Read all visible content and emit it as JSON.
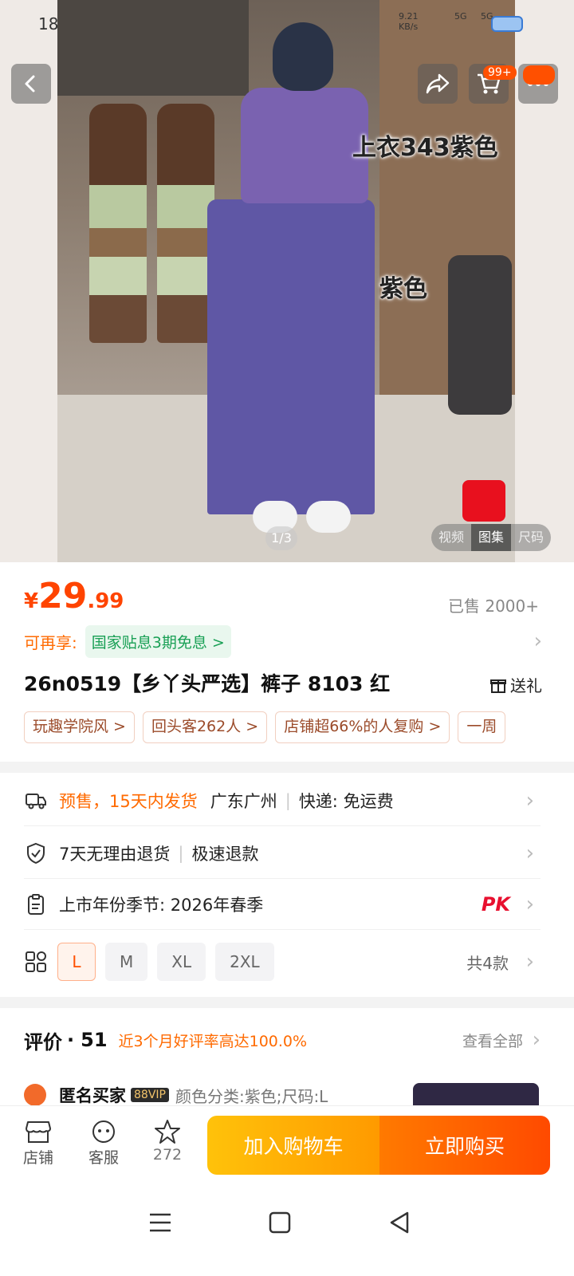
{
  "status_bar": {
    "time": "18",
    "net_speed_value": "9.21",
    "net_speed_unit": "KB/s",
    "sig1": "5G",
    "sig2": "5G"
  },
  "gallery": {
    "caption_top": "上衣343紫色",
    "caption_pants": "紫色",
    "counter": "1/3",
    "tabs": [
      "视频",
      "图集",
      "尺码"
    ],
    "active_tab": "图集",
    "cart_badge": "99+"
  },
  "price": {
    "symbol": "¥",
    "integer": "29",
    "decimal": ".99",
    "sold_label": "已售",
    "sold_count": "2000+"
  },
  "promo": {
    "label": "可再享:",
    "tag": "国家贴息3期免息 >"
  },
  "product": {
    "title": "26n0519【乡丫头严选】裤子 8103 红",
    "gift_label": "送礼"
  },
  "chips": [
    "玩趣学院风 >",
    "回头客262人 >",
    "店铺超66%的人复购 >",
    "一周"
  ],
  "shipping": {
    "presale": "预售，15天内发货",
    "origin": "广东广州",
    "express_label": "快递:",
    "express_value": "免运费"
  },
  "returns": {
    "policy": "7天无理由退货",
    "refund": "极速退款"
  },
  "season": {
    "text": "上市年份季节: 2026年春季",
    "pk": "PK"
  },
  "sizes": {
    "options": [
      "L",
      "M",
      "XL",
      "2XL"
    ],
    "selected": "L",
    "count": "共4款"
  },
  "reviews": {
    "title": "评价",
    "dot": "·",
    "count": "51",
    "rate_text": "近3个月好评率高达100.0%",
    "view_all": "查看全部",
    "first": {
      "user": "匿名买家",
      "vip": "88VIP",
      "spec": "颜色分类:紫色;尺码:L"
    }
  },
  "bottom_bar": {
    "store": "店铺",
    "service": "客服",
    "fav_count": "272",
    "add_to_cart": "加入购物车",
    "buy_now": "立即购买"
  },
  "colors": {
    "accent": "#ff5000",
    "price": "#ff4400",
    "green": "#19a055"
  }
}
